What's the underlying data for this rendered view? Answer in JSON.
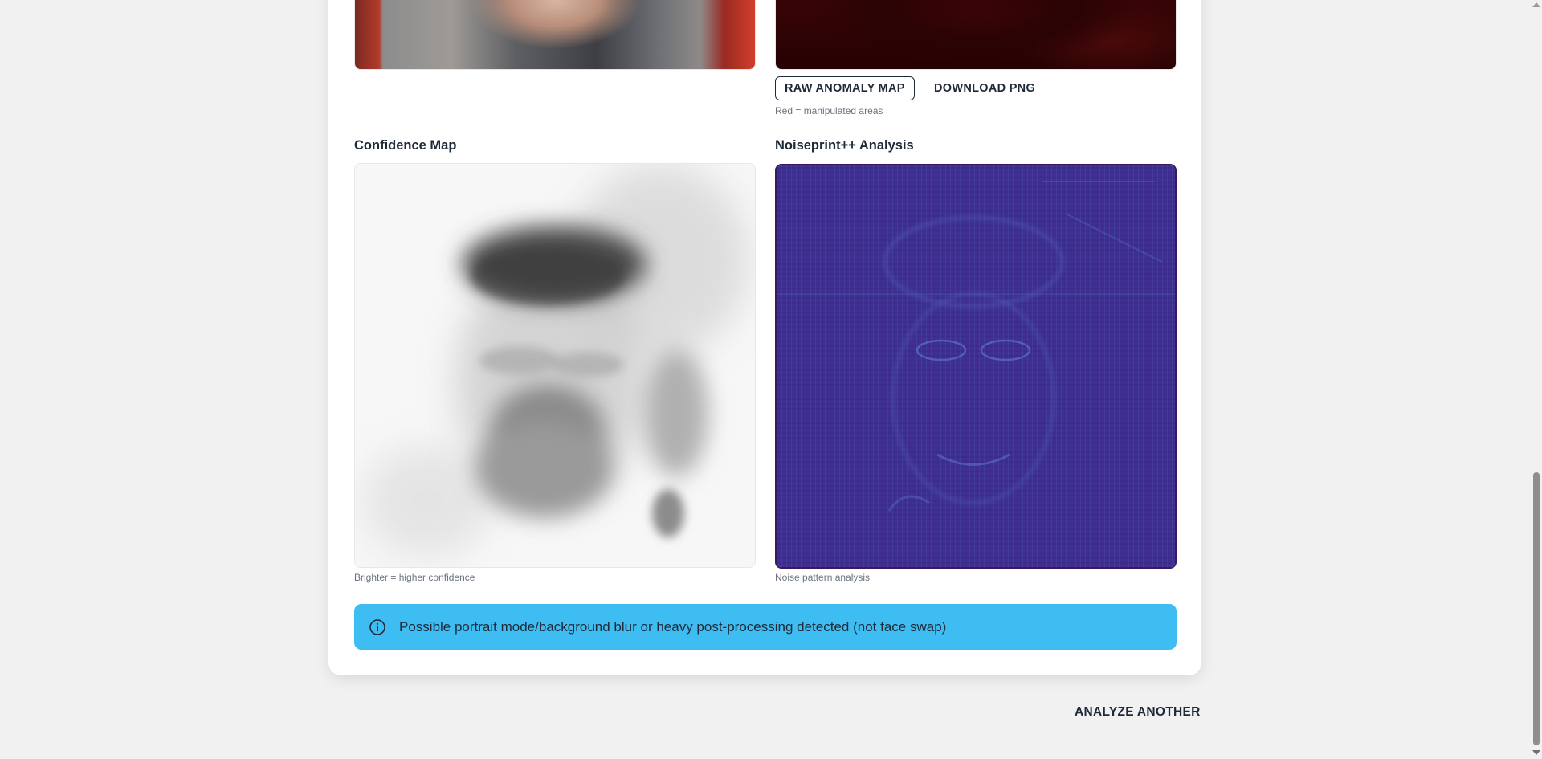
{
  "anomaly_section": {
    "raw_button_label": "RAW ANOMALY MAP",
    "download_button_label": "DOWNLOAD PNG",
    "caption": "Red = manipulated areas"
  },
  "confidence_section": {
    "title": "Confidence Map",
    "caption": "Brighter = higher confidence"
  },
  "noise_section": {
    "title": "Noiseprint++ Analysis",
    "caption": "Noise pattern analysis"
  },
  "alert": {
    "icon": "info-icon",
    "message": "Possible portrait mode/background blur or heavy post-processing detected (not face swap)",
    "background_color": "#3dbdf2"
  },
  "footer": {
    "analyze_another_label": "ANALYZE ANOTHER"
  },
  "colors": {
    "page_background": "#f1f1f1",
    "card_background": "#ffffff",
    "noise_map_base": "#3d2b8e"
  }
}
